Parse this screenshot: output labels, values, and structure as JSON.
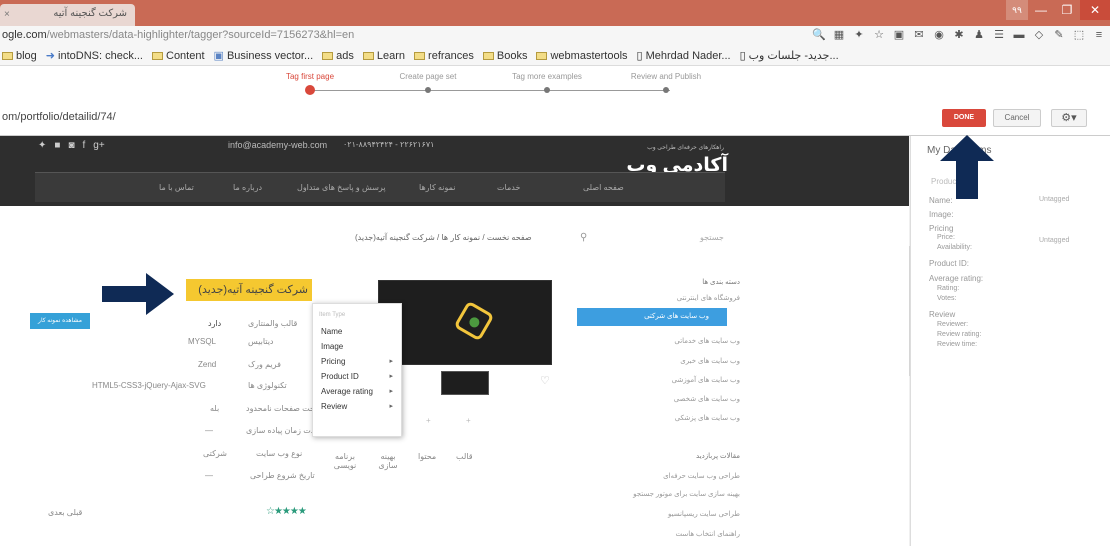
{
  "browser": {
    "tab_title": "شرکت گنجینه آتیه",
    "tab_close": "×",
    "user_chip": "۹۹",
    "url_host": "ogle.com",
    "url_path": "/webmasters/data-highlighter/tagger?sourceId=7156273&hl=en",
    "ext_icons": [
      "zoom-icon",
      "grid-icon",
      "pin-icon",
      "star-icon",
      "mail-icon",
      "gmail-icon",
      "lastpass-icon",
      "gear-icon",
      "user-icon",
      "list-icon",
      "ad-icon",
      "tag-icon",
      "pen-icon",
      "stack-icon",
      "menu-icon"
    ],
    "bookmarks": [
      {
        "label": "blog",
        "icon": "folder-icon"
      },
      {
        "label": "intoDNS: check...",
        "icon": "link-icon"
      },
      {
        "label": "Content",
        "icon": "folder-icon"
      },
      {
        "label": "Business vector...",
        "icon": "image-icon"
      },
      {
        "label": "ads",
        "icon": "folder-icon"
      },
      {
        "label": "Learn",
        "icon": "folder-icon"
      },
      {
        "label": "refrances",
        "icon": "folder-icon"
      },
      {
        "label": "Books",
        "icon": "folder-icon"
      },
      {
        "label": "webmastertools",
        "icon": "folder-icon"
      },
      {
        "label": "Mehrdad Nader...",
        "icon": "page-icon"
      },
      {
        "label": "جدید- جلسات وب...",
        "icon": "page-icon"
      }
    ]
  },
  "highlighter": {
    "steps": [
      {
        "label": "Tag first page",
        "active": true
      },
      {
        "label": "Create page set",
        "active": false
      },
      {
        "label": "Tag more examples",
        "active": false
      },
      {
        "label": "Review and Publish",
        "active": false
      }
    ],
    "page_url": "om/portfolio/detailid/74/",
    "done_label": "DONE",
    "cancel_label": "Cancel",
    "gear_label": "⚙▾",
    "accent_color": "#d9483b"
  },
  "site": {
    "email": "info@academy-web.com",
    "phone": "۰۲۱-۸۸۹۴۲۴۲۴ - ۲۲۶۲۱۶۷۱",
    "logo_text": "آکادمی وب",
    "logo_tagline": "راهکارهای حرفه‌ای طراحی وب",
    "social_icons": [
      "twitter-icon",
      "linkedin-icon",
      "instagram-icon",
      "facebook-icon",
      "googleplus-icon"
    ],
    "menu": [
      "صفحه اصلی",
      "خدمات",
      "نمونه کارها",
      "پرسش و پاسخ های متداول",
      "درباره ما",
      "تماس با ما"
    ],
    "breadcrumb": "صفحه نخست  /  نمونه کار ها  /  شرکت گنجینه آتیه(جدید)",
    "sidebar_search": "جستجو",
    "title": "شرکت گنجینه آتیه(جدید)",
    "blue_button": "مشاهده نمونه کار",
    "info": [
      {
        "label": "قالب والمنتاری",
        "value": "دارد"
      },
      {
        "label": "دیتابیس",
        "value": "MYSQL"
      },
      {
        "label": "فریم ورک",
        "value": "Zend"
      },
      {
        "label": "تکنولوژی ها",
        "value": "HTML5-CSS3-jQuery-Ajax-SVG"
      },
      {
        "label": "امکان ساخت صفحات نامحدود",
        "value": "بله"
      },
      {
        "label": "مدت زمان پیاده سازی",
        "value": "—"
      },
      {
        "label": "نوع وب سایت",
        "value": "شرکتی"
      },
      {
        "label": "تاریخ شروع طراحی",
        "value": "—"
      }
    ],
    "grid_cols": [
      "قالب",
      "محتوا",
      "بهینه سازی",
      "برنامه نویسی"
    ],
    "stars": "☆★★★★",
    "category_title": "دسته بندی ها",
    "categories": [
      "فروشگاه های اینترنتی",
      "وب سایت های شرکتی",
      "وب سایت های خدماتی",
      "وب سایت های خبری",
      "وب سایت های آموزشی",
      "وب سایت های شخصی",
      "وب سایت های پزشکی"
    ],
    "active_category": "وب سایت های شرکتی",
    "popular_title": "مقالات پربازدید",
    "articles": [
      "طراحی وب سایت حرفه‌ای",
      "بهینه سازی سایت برای موتور جستجو",
      "طراحی سایت ریسپانسیو",
      "راهنمای انتخاب هاست"
    ],
    "bottom_left": "قبلی   بعدی"
  },
  "context_menu": {
    "header": "Item Type",
    "items": [
      {
        "label": "Name",
        "submenu": false
      },
      {
        "label": "Image",
        "submenu": false
      },
      {
        "label": "Pricing",
        "submenu": true
      },
      {
        "label": "Product ID",
        "submenu": true
      },
      {
        "label": "Average rating",
        "submenu": true
      },
      {
        "label": "Review",
        "submenu": true
      }
    ]
  },
  "panel": {
    "title": "My Data Items",
    "subtitle": "Product",
    "rows": [
      {
        "label": "Name:",
        "value": "Untagged"
      },
      {
        "label": "Image:",
        "value": ""
      },
      {
        "label": "Pricing",
        "value": "Untagged"
      },
      {
        "label": "Price:",
        "value": ""
      },
      {
        "label": "Availability:",
        "value": ""
      },
      {
        "label": "Product ID:",
        "value": ""
      },
      {
        "label": "Average rating:",
        "value": ""
      },
      {
        "label": "Rating:",
        "value": ""
      },
      {
        "label": "Votes:",
        "value": ""
      },
      {
        "label": "Review",
        "value": ""
      },
      {
        "label": "Reviewer:",
        "value": ""
      },
      {
        "label": "Review rating:",
        "value": ""
      },
      {
        "label": "Review time:",
        "value": ""
      }
    ]
  },
  "arrow_color": "#0f2a55"
}
